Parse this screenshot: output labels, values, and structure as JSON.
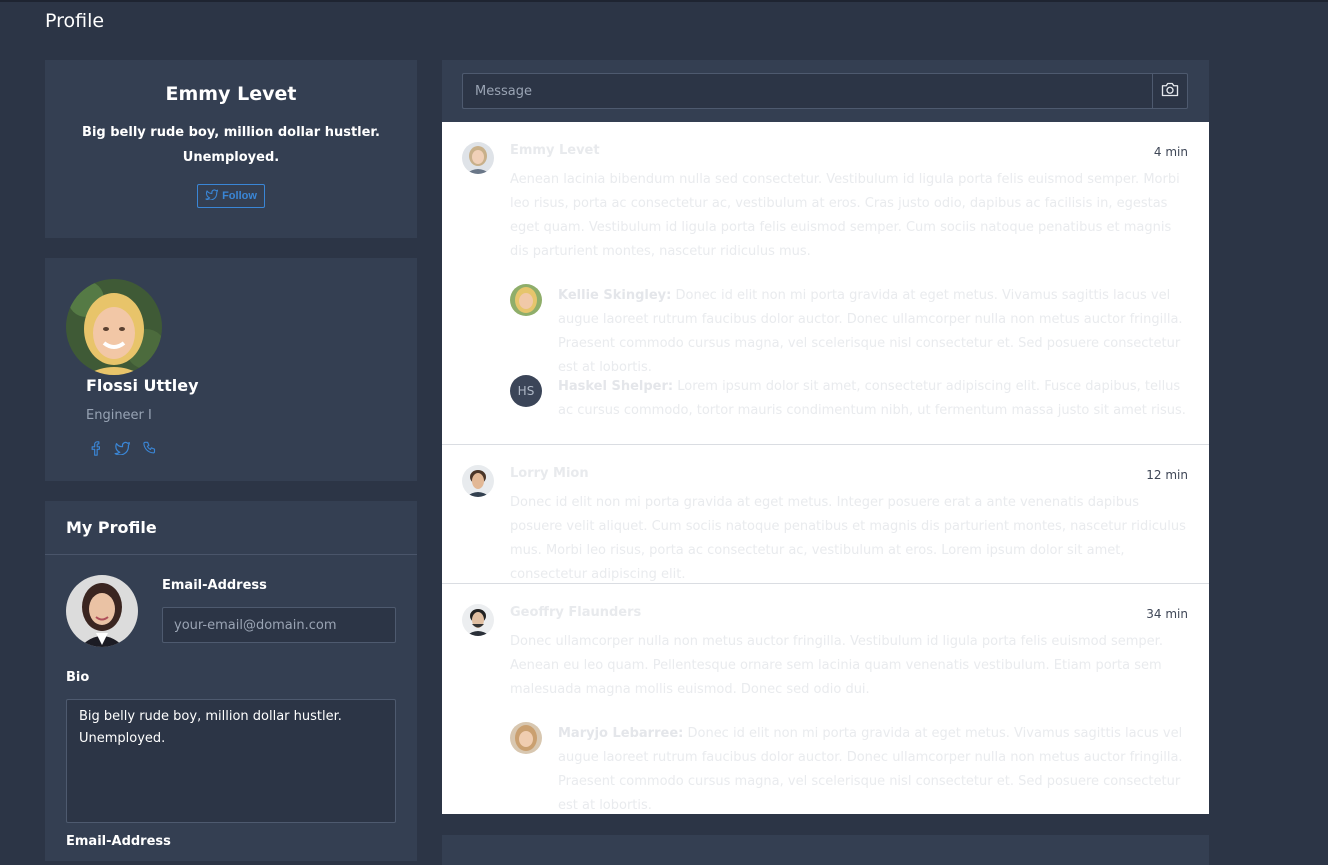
{
  "page": {
    "title": "Profile"
  },
  "header_card": {
    "name": "Emmy Levet",
    "bio": "Big belly rude boy, million dollar hustler. Unemployed.",
    "follow_label": "Follow"
  },
  "person_card": {
    "name": "Flossi Uttley",
    "role": "Engineer I",
    "social_icons": [
      "facebook-icon",
      "twitter-icon",
      "phone-icon"
    ]
  },
  "my_profile": {
    "title": "My Profile",
    "email_label": "Email-Address",
    "email_value": "",
    "email_placeholder": "your-email@domain.com",
    "bio_label": "Bio",
    "bio_value": "Big belly rude boy, million dollar hustler. Unemployed.",
    "email_label_2": "Email-Address"
  },
  "composer": {
    "placeholder": "Message",
    "camera_icon": "camera-icon"
  },
  "feed": [
    {
      "author": "Emmy Levet",
      "time": "4 min",
      "text": "Aenean lacinia bibendum nulla sed consectetur. Vestibulum id ligula porta felis euismod semper. Morbi leo risus, porta ac consectetur ac, vestibulum at eros. Cras justo odio, dapibus ac facilisis in, egestas eget quam. Vestibulum id ligula porta felis euismod semper. Cum sociis natoque penatibus et magnis dis parturient montes, nascetur ridiculus mus.",
      "replies": [
        {
          "author": "Kellie Skingley:",
          "text": "Donec id elit non mi porta gravida at eget metus. Vivamus sagittis lacus vel augue laoreet rutrum faucibus dolor auctor. Donec ullamcorper nulla non metus auctor fringilla. Praesent commodo cursus magna, vel scelerisque nisl consectetur et. Sed posuere consectetur est at lobortis."
        },
        {
          "author": "Haskel Shelper:",
          "initials": "HS",
          "text": "Lorem ipsum dolor sit amet, consectetur adipiscing elit. Fusce dapibus, tellus ac cursus commodo, tortor mauris condimentum nibh, ut fermentum massa justo sit amet risus."
        }
      ]
    },
    {
      "author": "Lorry Mion",
      "time": "12 min",
      "text": "Donec id elit non mi porta gravida at eget metus. Integer posuere erat a ante venenatis dapibus posuere velit aliquet. Cum sociis natoque penatibus et magnis dis parturient montes, nascetur ridiculus mus. Morbi leo risus, porta ac consectetur ac, vestibulum at eros. Lorem ipsum dolor sit amet, consectetur adipiscing elit."
    },
    {
      "author": "Geoffry Flaunders",
      "time": "34 min",
      "text": "Donec ullamcorper nulla non metus auctor fringilla. Vestibulum id ligula porta felis euismod semper. Aenean eu leo quam. Pellentesque ornare sem lacinia quam venenatis vestibulum. Etiam porta sem malesuada magna mollis euismod. Donec sed odio dui.",
      "replies": [
        {
          "author": "Maryjo Lebarree:",
          "text": "Donec id elit non mi porta gravida at eget metus. Vivamus sagittis lacus vel augue laoreet rutrum faucibus dolor auctor. Donec ullamcorper nulla non metus auctor fringilla. Praesent commodo cursus magna, vel scelerisque nisl consectetur et. Sed posuere consectetur est at lobortis."
        }
      ]
    }
  ],
  "colors": {
    "accent": "#3a86d6",
    "card": "#343f52",
    "background": "#2c3546"
  }
}
